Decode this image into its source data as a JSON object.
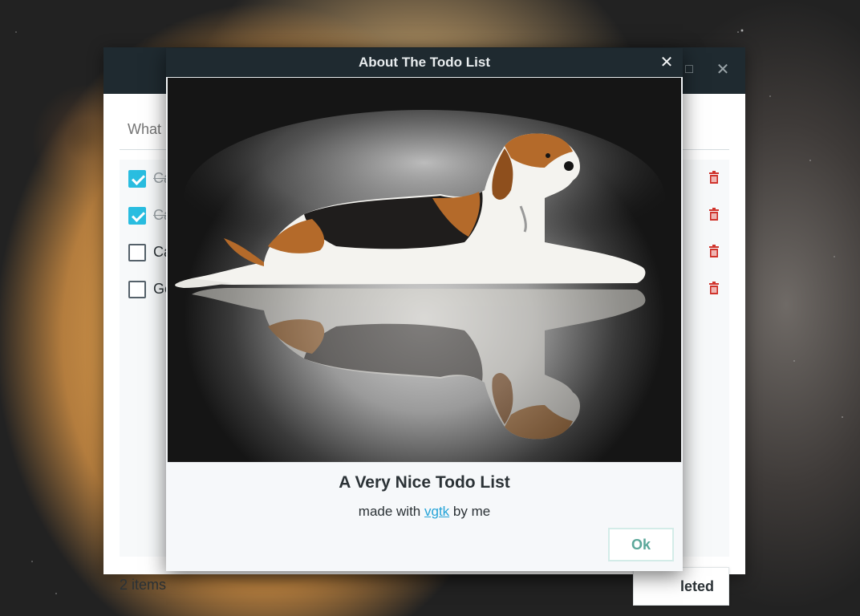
{
  "main_window": {
    "title_controls": {
      "maximize": "□",
      "close": "✕"
    },
    "input_placeholder": "What",
    "items": [
      {
        "text": "Ca",
        "done": true
      },
      {
        "text": "Ca",
        "done": true
      },
      {
        "text": "Ca",
        "done": false
      },
      {
        "text": "Ge",
        "done": false
      }
    ],
    "footer": {
      "count": "2 items",
      "clear_label": "leted"
    }
  },
  "dialog": {
    "title": "About The Todo List",
    "close": "✕",
    "heading": "A Very Nice Todo List",
    "subtitle_prefix": "made with ",
    "subtitle_link": "vgtk",
    "subtitle_suffix": " by me",
    "ok_label": "Ok"
  },
  "colors": {
    "titlebar": "#1f2a30",
    "checkbox_checked": "#29bde0",
    "trash": "#d0342c",
    "ok_text": "#5ba79a",
    "link": "#24a3d8"
  }
}
